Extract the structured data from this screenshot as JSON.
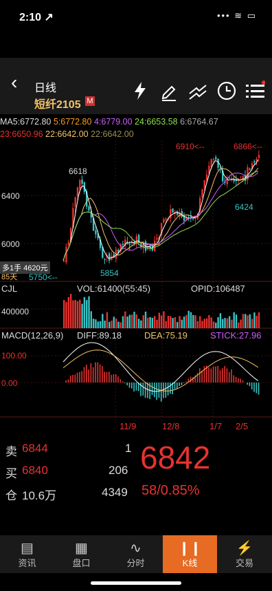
{
  "status": {
    "time": "2:10 ↗",
    "icons": "••• ≋ ▭"
  },
  "header": {
    "title": "日线",
    "code": "短纤2105",
    "mtag": "M",
    "buttons": [
      "bolt-icon",
      "pen-icon",
      "trend-icon",
      "clock-icon",
      "menu-icon"
    ]
  },
  "ma": {
    "ma5": "MA5:6772.80",
    "ma5b": "5:6772.80",
    "ma4": "4:6779.00",
    "ma24": "24:6653.58",
    "ma6": "6:6764.67",
    "ma23": "23:6650.96",
    "ma22a": "22:6642.00",
    "ma22b": "22:6642.00"
  },
  "price_chart": {
    "y_labels": [
      "6400",
      "6000"
    ],
    "peak_labels": [
      "6618",
      "6910<--",
      "6866<--"
    ],
    "low_labels": [
      "5854",
      "6424",
      "5750<--"
    ],
    "tooltip": "多1手 4620元",
    "tooltip2": "85天"
  },
  "volume": {
    "label": "CJL",
    "vol": "VOL:61400(55:45)",
    "opid": "OPID:106487",
    "y_label": "400000"
  },
  "macd": {
    "label": "MACD(12,26,9)",
    "diff": "DIFF:89.18",
    "dea": "DEA:75.19",
    "stick": "STICK:27.96",
    "y_labels": [
      "100.00",
      "0.00"
    ],
    "dates": [
      "11/9",
      "12/8",
      "1/7",
      "2/5"
    ]
  },
  "quote": {
    "sell_label": "卖",
    "sell_price": "6844",
    "sell_qty": "1",
    "buy_label": "买",
    "buy_price": "6840",
    "buy_qty": "206",
    "pos_label": "仓",
    "pos_value": "10.6万",
    "pos_qty": "4349",
    "last": "6842",
    "change": "58/0.85%"
  },
  "tabs": [
    {
      "label": "资讯",
      "icon": "news-icon"
    },
    {
      "label": "盘口",
      "icon": "orderbook-icon"
    },
    {
      "label": "分时",
      "icon": "timeshare-icon"
    },
    {
      "label": "K线",
      "icon": "candle-icon"
    },
    {
      "label": "交易",
      "icon": "trade-icon"
    }
  ],
  "colors": {
    "up": "#e8322f",
    "down": "#38c4c4",
    "accent": "#e76b22",
    "gold": "#f3c46b"
  }
}
